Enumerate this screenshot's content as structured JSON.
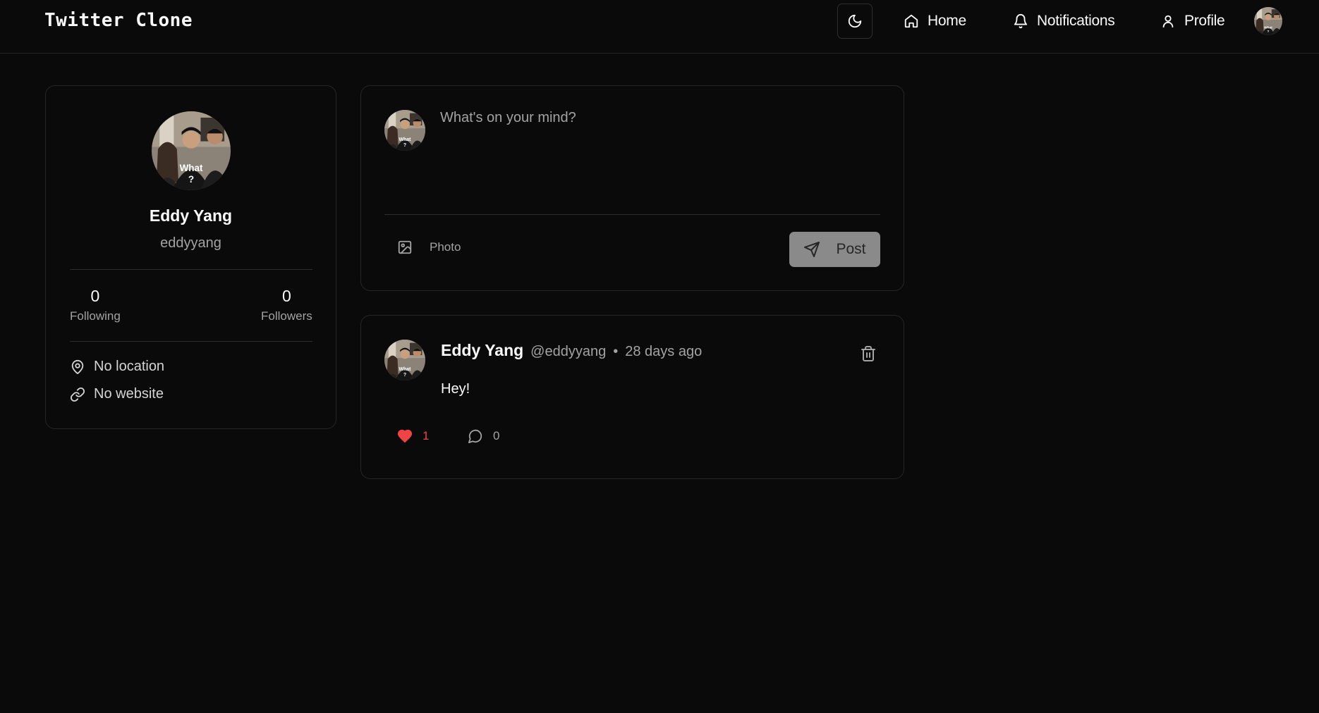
{
  "navbar": {
    "brand": "Twitter Clone",
    "links": [
      {
        "label": "Home",
        "icon": "home-icon"
      },
      {
        "label": "Notifications",
        "icon": "bell-icon"
      },
      {
        "label": "Profile",
        "icon": "user-icon"
      }
    ],
    "theme_toggle_icon": "moon-icon"
  },
  "profile": {
    "name": "Eddy Yang",
    "username": "eddyyang",
    "following_count": "0",
    "following_label": "Following",
    "followers_count": "0",
    "followers_label": "Followers",
    "location": "No location",
    "website": "No website"
  },
  "composer": {
    "placeholder": "What's on your mind?",
    "photo_label": "Photo",
    "post_label": "Post"
  },
  "posts": [
    {
      "author": "Eddy Yang",
      "handle": "@eddyyang",
      "separator": "•",
      "time": "28 days ago",
      "content": "Hey!",
      "likes": "1",
      "comments": "0"
    }
  ],
  "colors": {
    "background": "#0a0a0a",
    "border": "#262626",
    "text": "#fafafa",
    "muted": "#a3a3a3",
    "like": "#ef4444",
    "post_button": "#8a8a8a"
  }
}
